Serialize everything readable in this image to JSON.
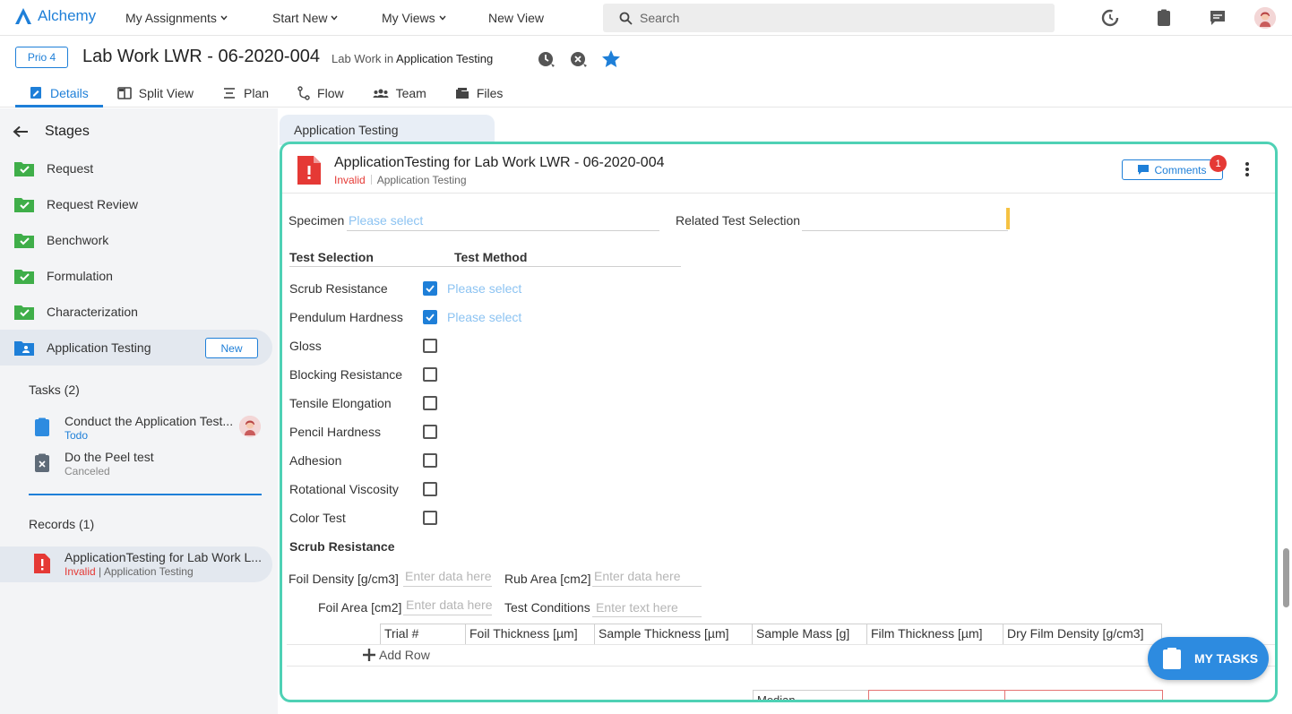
{
  "topbar": {
    "logo_text": "Alchemy",
    "nav": [
      "My Assignments",
      "Start New",
      "My Views",
      "New View"
    ],
    "search_placeholder": "Search"
  },
  "record": {
    "priority": "Prio 4",
    "title": "Lab Work LWR - 06-2020-004",
    "subtitle_prefix": "Lab Work in",
    "subtitle_stage": "Application Testing",
    "tabs": [
      {
        "label": "Details",
        "icon": "details-icon",
        "active": true
      },
      {
        "label": "Split View",
        "icon": "split-view-icon",
        "active": false
      },
      {
        "label": "Plan",
        "icon": "plan-icon",
        "active": false
      },
      {
        "label": "Flow",
        "icon": "flow-icon",
        "active": false
      },
      {
        "label": "Team",
        "icon": "team-icon",
        "active": false
      },
      {
        "label": "Files",
        "icon": "files-icon",
        "active": false
      }
    ]
  },
  "sidebar": {
    "stages_title": "Stages",
    "stages": [
      {
        "label": "Request",
        "status": "done"
      },
      {
        "label": "Request Review",
        "status": "done"
      },
      {
        "label": "Benchwork",
        "status": "done"
      },
      {
        "label": "Formulation",
        "status": "done"
      },
      {
        "label": "Characterization",
        "status": "done"
      },
      {
        "label": "Application Testing",
        "status": "active",
        "badge": "New"
      }
    ],
    "tasks_title": "Tasks (2)",
    "tasks": [
      {
        "title": "Conduct the Application Test...",
        "status": "Todo"
      },
      {
        "title": "Do the Peel test",
        "status": "Canceled"
      }
    ],
    "records_title": "Records (1)",
    "records": [
      {
        "title": "ApplicationTesting for Lab Work L...",
        "status": "Invalid",
        "stage": "Application Testing"
      }
    ]
  },
  "main": {
    "stage_tab": "Application Testing",
    "card": {
      "title": "ApplicationTesting for Lab Work LWR - 06-2020-004",
      "status": "Invalid",
      "stage": "Application Testing",
      "comments_label": "Comments",
      "comments_count": "1"
    },
    "fields": {
      "specimen_label": "Specimen",
      "specimen_placeholder": "Please select",
      "related_label": "Related Test Selection",
      "test_selection_header": "Test Selection",
      "test_method_header": "Test Method"
    },
    "tests": [
      {
        "label": "Scrub Resistance",
        "checked": true,
        "method_placeholder": "Please select"
      },
      {
        "label": "Pendulum Hardness",
        "checked": true,
        "method_placeholder": "Please select"
      },
      {
        "label": "Gloss",
        "checked": false
      },
      {
        "label": "Blocking Resistance",
        "checked": false
      },
      {
        "label": "Tensile Elongation",
        "checked": false
      },
      {
        "label": "Pencil Hardness",
        "checked": false
      },
      {
        "label": "Adhesion",
        "checked": false
      },
      {
        "label": "Rotational Viscosity",
        "checked": false
      },
      {
        "label": "Color Test",
        "checked": false
      }
    ],
    "scrub": {
      "section_title": "Scrub Resistance",
      "foil_density_label": "Foil Density [g/cm3]",
      "foil_density_placeholder": "Enter data here",
      "rub_area_label": "Rub Area [cm2]",
      "rub_area_placeholder": "Enter data here",
      "foil_area_label": "Foil Area [cm2]",
      "foil_area_placeholder": "Enter data here",
      "test_conditions_label": "Test Conditions",
      "test_conditions_placeholder": "Enter text here",
      "table_columns": [
        "Trial #",
        "Foil Thickness [µm]",
        "Sample Thickness [µm]",
        "Sample Mass [g]",
        "Film Thickness [µm]",
        "Dry Film Density [g/cm3]"
      ],
      "add_row_label": "Add Row",
      "median_label": "Median"
    }
  },
  "fab": {
    "label": "MY TASKS"
  },
  "colors": {
    "accent": "#1e7fd8",
    "card_border": "#4fd1b5",
    "invalid": "#e53935",
    "stage_done": "#3fae49"
  }
}
